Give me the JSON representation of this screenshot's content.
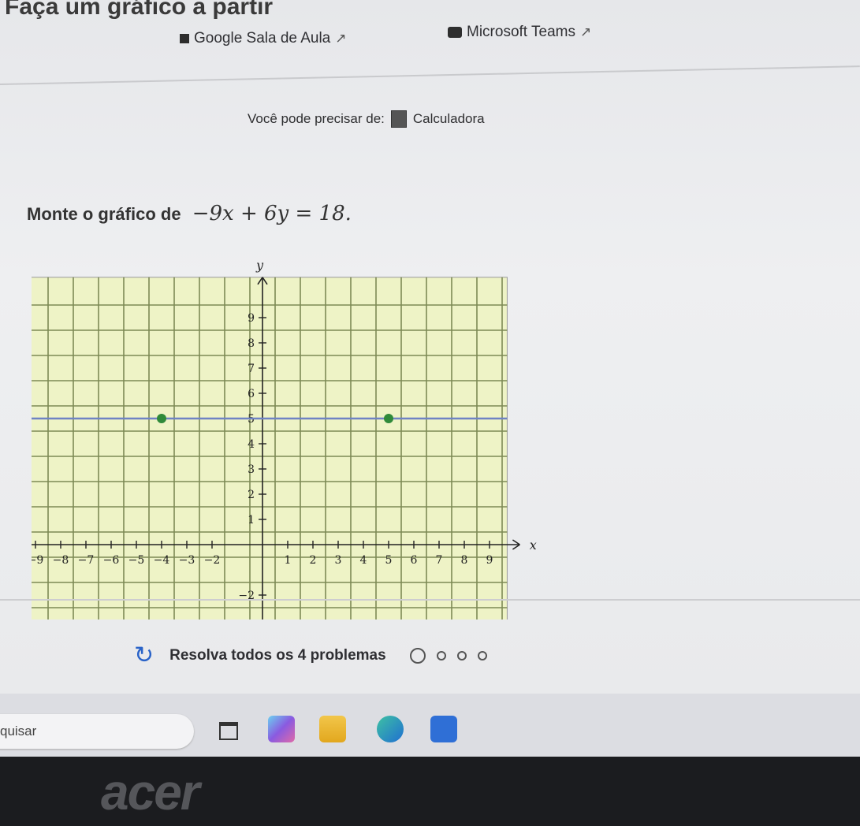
{
  "header": {
    "title": "Faça um gráfico a partir"
  },
  "links": {
    "classroom": "Google Sala de Aula",
    "teams": "Microsoft Teams"
  },
  "tools": {
    "prefix": "Você pode precisar de:",
    "calculator": "Calculadora"
  },
  "question": {
    "prompt": "Monte o gráfico de",
    "equation": "−9x + 6y = 18."
  },
  "graph": {
    "y_label": "y",
    "x_label": "x",
    "x_ticks": [
      "−9",
      "−8",
      "−7",
      "−6",
      "−5",
      "−4",
      "−3",
      "−2",
      "1",
      "2",
      "3",
      "4",
      "5",
      "6",
      "7",
      "8",
      "9"
    ],
    "y_ticks": [
      "9",
      "8",
      "7",
      "6",
      "5",
      "4",
      "3",
      "2",
      "1",
      "−2"
    ],
    "points": [
      {
        "x": -4,
        "y": 5
      },
      {
        "x": 5,
        "y": 5
      }
    ],
    "line_color": "#6f83c4",
    "point_color": "#2f8a3a",
    "grid_fill": "#eef3c6"
  },
  "progress": {
    "text": "Resolva todos os 4 problemas",
    "total": 4,
    "completed": 0
  },
  "taskbar": {
    "search_placeholder": "quisar"
  },
  "bezel": {
    "brand": "acer"
  }
}
